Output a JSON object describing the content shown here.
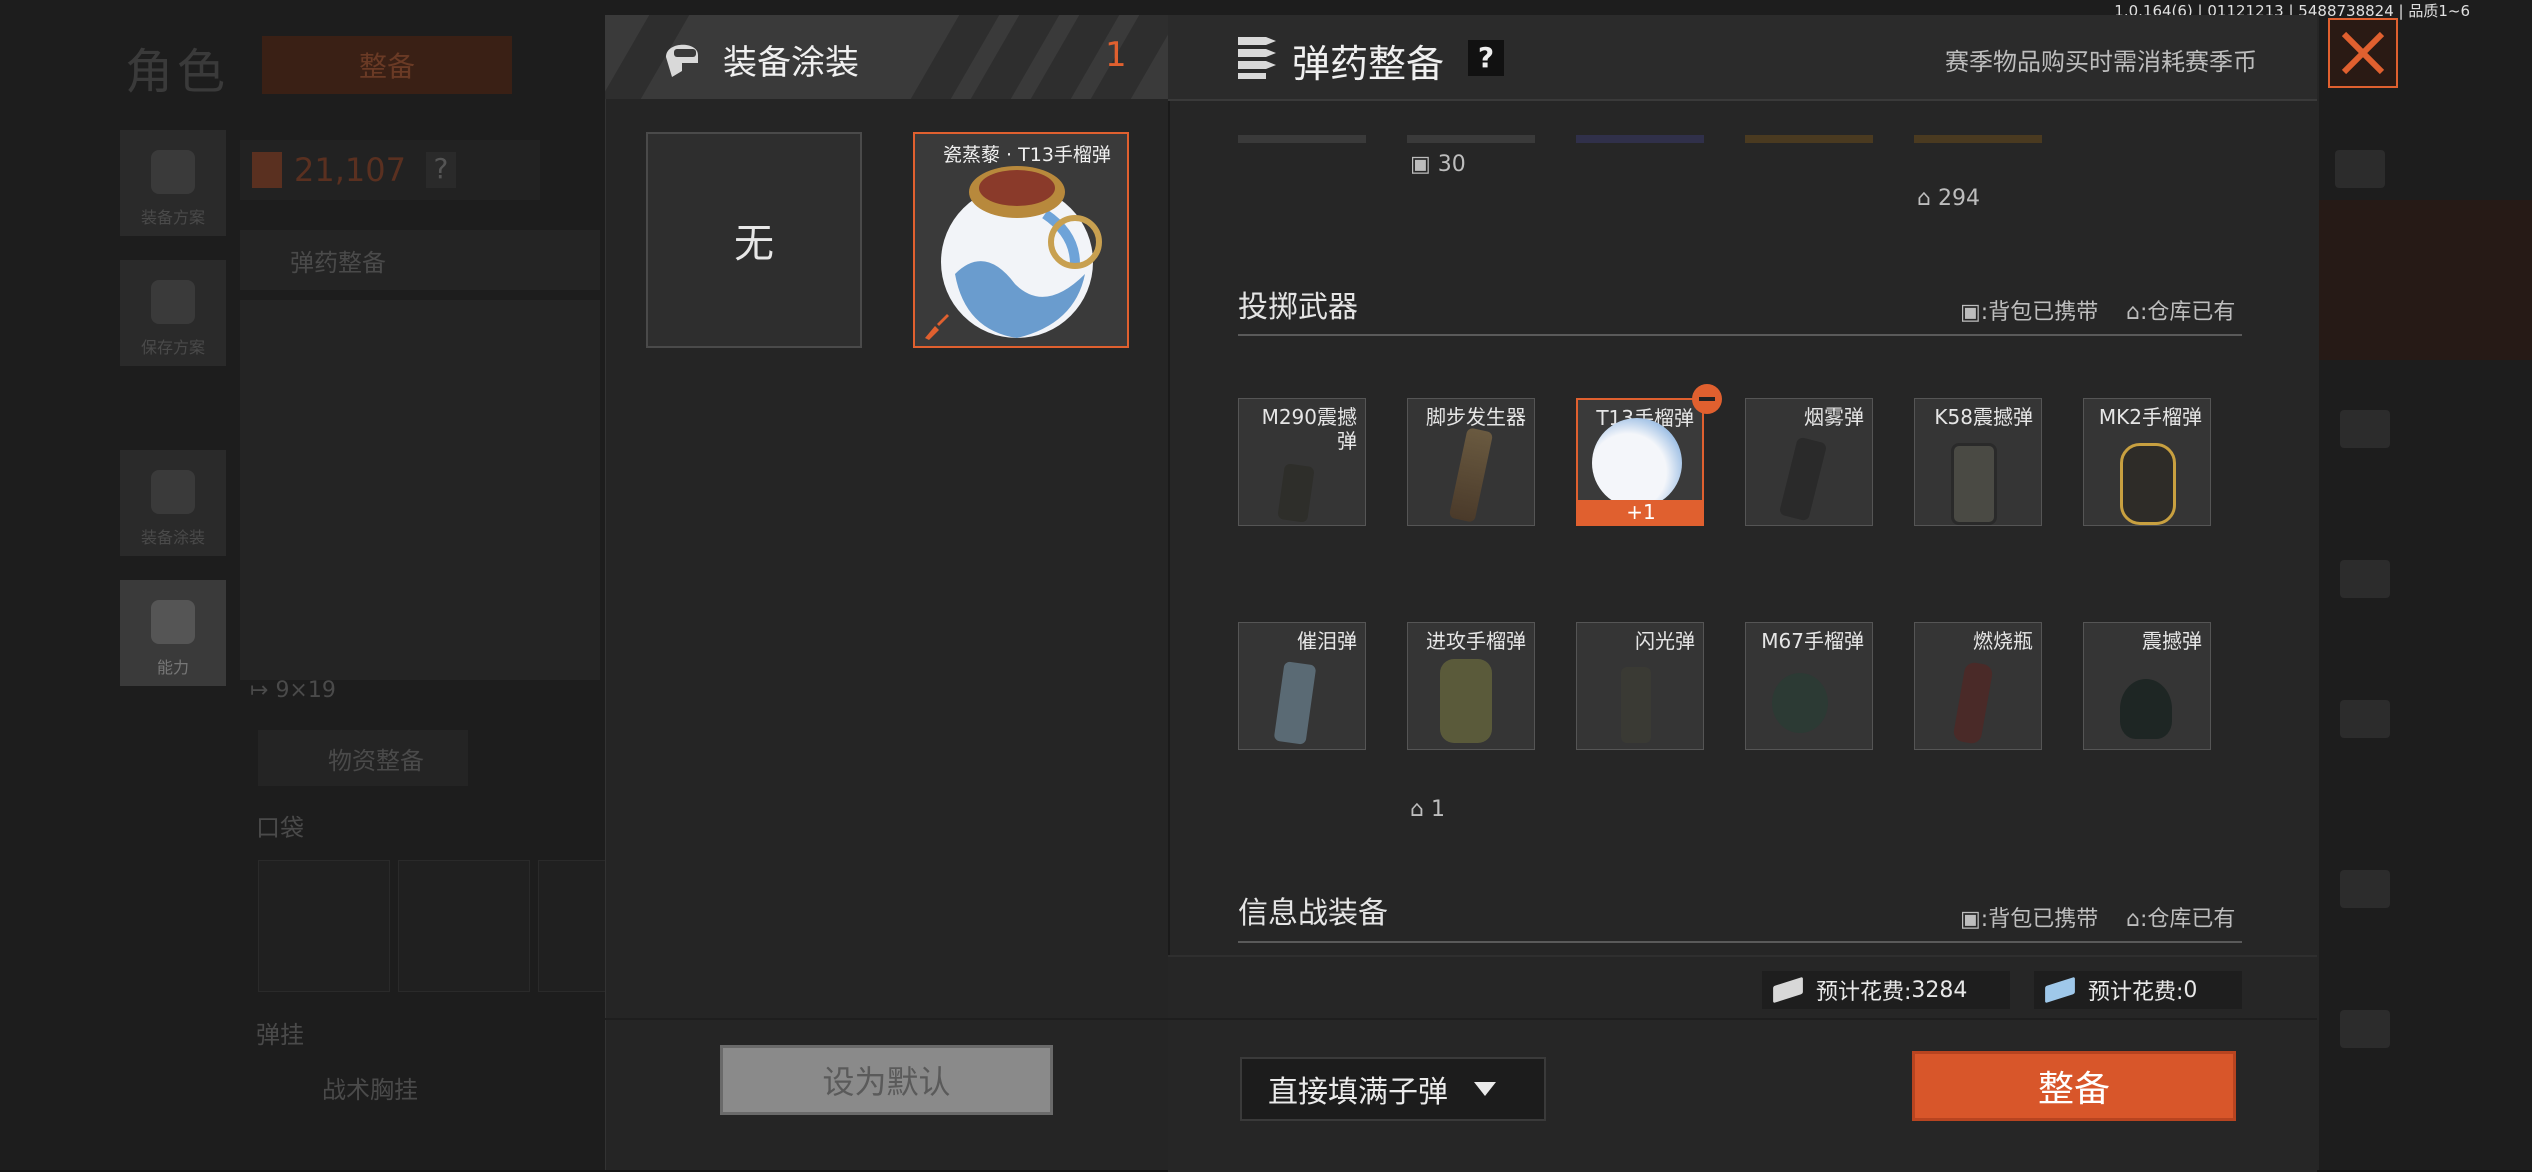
{
  "version_text": "1.0.164(6) | 01121213 | 5488738824 | 品质1~6",
  "background": {
    "title": "角色",
    "tab_label": "整备",
    "currency_value": "21,107",
    "help_mark": "?",
    "ammo_btn": "弹药整备",
    "sidebar": [
      {
        "label": "装备方案",
        "icon": "vest-icon"
      },
      {
        "label": "保存方案",
        "icon": "download-icon"
      },
      {
        "label": "装备涂装",
        "icon": "helmet-icon"
      },
      {
        "label": "能力",
        "icon": "ability-icon"
      }
    ],
    "caliber": "9×19",
    "supply_btn": "物资整备",
    "pocket_label": "口袋",
    "sling_label": "弹挂",
    "chest_rig": "战术胸挂"
  },
  "skin_panel": {
    "title": "装备涂装",
    "count": "1",
    "slots": [
      {
        "label": "无",
        "selected": false
      },
      {
        "label": "瓷蒸藜 · T13手榴弹",
        "selected": true
      }
    ],
    "set_default_btn": "设为默认"
  },
  "ammo_panel": {
    "title": "弹药整备",
    "help_mark": "?",
    "season_note": "赛季物品购买时需消耗赛季币",
    "top_counts": {
      "backpack": "30",
      "warehouse": "294"
    },
    "throwables": {
      "title": "投掷武器",
      "legend_backpack": ":背包已携带",
      "legend_warehouse": ":仓库已有",
      "items": [
        {
          "name": "M290震撼\n弹",
          "icon": "m290-grenade-icon"
        },
        {
          "name": "脚步发生器",
          "icon": "footstep-generator-icon"
        },
        {
          "name": "T13手榴弹",
          "icon": "t13-grenade-icon",
          "selected": true,
          "badge": "+1"
        },
        {
          "name": "烟雾弹",
          "icon": "smoke-grenade-icon"
        },
        {
          "name": "K58震撼弹",
          "icon": "k58-grenade-icon"
        },
        {
          "name": "MK2手榴弹",
          "icon": "mk2-grenade-icon"
        },
        {
          "name": "催泪弹",
          "icon": "tear-gas-icon"
        },
        {
          "name": "进攻手榴弹",
          "icon": "offensive-grenade-icon"
        },
        {
          "name": "闪光弹",
          "icon": "flashbang-icon"
        },
        {
          "name": "M67手榴弹",
          "icon": "m67-grenade-icon"
        },
        {
          "name": "燃烧瓶",
          "icon": "molotov-icon"
        },
        {
          "name": "震撼弹",
          "icon": "stun-grenade-icon"
        }
      ],
      "warehouse_count": "1"
    },
    "info_war": {
      "title": "信息战装备",
      "legend_backpack": ":背包已携带",
      "legend_warehouse": ":仓库已有"
    },
    "costs": [
      {
        "label": "预计花费:",
        "value": "3284"
      },
      {
        "label": "预计花费:",
        "value": "0"
      }
    ],
    "fill_select": "直接填满子弹",
    "prep_btn": "整备"
  },
  "colors": {
    "accent": "#e0602f",
    "badge": "#e0602f",
    "panel": "#262626"
  }
}
